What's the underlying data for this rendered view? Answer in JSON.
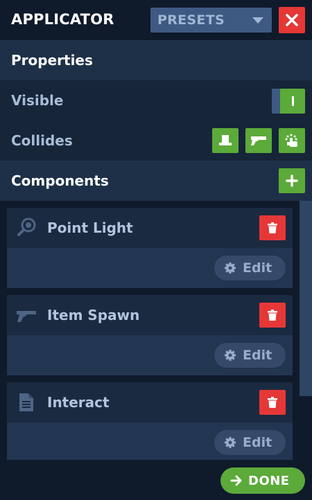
{
  "header": {
    "title": "APPLICATOR",
    "presets_label": "PRESETS"
  },
  "properties": {
    "section_label": "Properties",
    "visible_label": "Visible",
    "visible_on": true,
    "collides_label": "Collides",
    "collides_buttons": [
      "player-collide-icon",
      "weapon-collide-icon",
      "interact-collide-icon"
    ]
  },
  "components": {
    "section_label": "Components",
    "items": [
      {
        "title": "Point Light",
        "icon": "point-light-icon",
        "edit_label": "Edit"
      },
      {
        "title": "Item Spawn",
        "icon": "item-spawn-icon",
        "edit_label": "Edit"
      },
      {
        "title": "Interact",
        "icon": "interact-icon",
        "edit_label": "Edit"
      }
    ]
  },
  "footer": {
    "done_label": "DONE"
  },
  "colors": {
    "background": "#0f1a2b",
    "accent_green": "#5caa3a",
    "danger_red": "#e63737",
    "panel_blue": "#3e5a82"
  }
}
